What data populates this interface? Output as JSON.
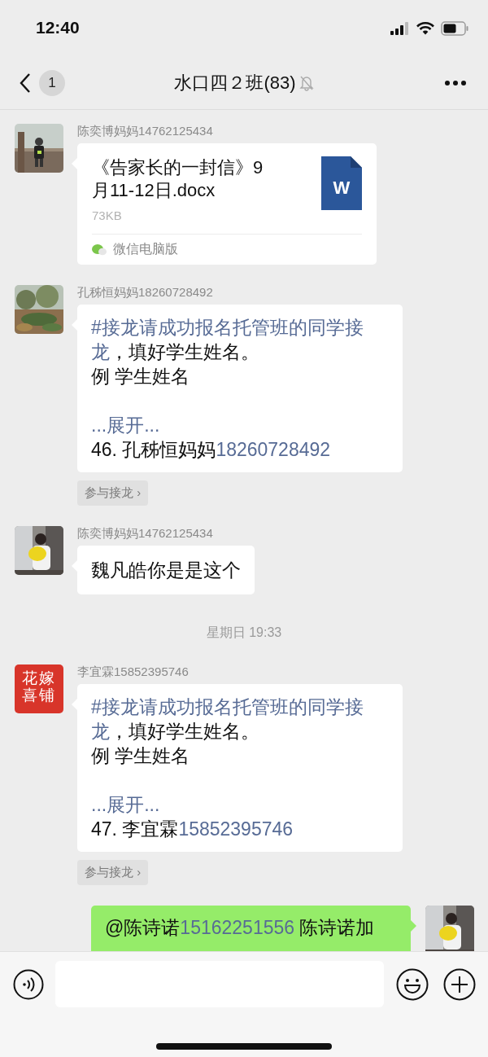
{
  "status_bar": {
    "time": "12:40"
  },
  "nav": {
    "back_count": "1",
    "title": "水口四２班(83)",
    "muted": true
  },
  "messages": [
    {
      "kind": "file",
      "sender": "陈奕博妈妈14762125434",
      "avatar": {
        "kind": "picture"
      },
      "file_name": "《告家长的一封信》9月11-12日.docx",
      "file_size": "73KB",
      "file_badge": "W",
      "source": "微信电脑版"
    },
    {
      "kind": "jielong",
      "sender": "孔秭恒妈妈18260728492",
      "avatar": {
        "kind": "picture"
      },
      "intro_link": "#接龙请成功报名托管班的同学接",
      "intro": [
        {
          "kind": "link",
          "text": "龙"
        },
        {
          "kind": "plain",
          "text": "，填好学生姓名。"
        }
      ],
      "example": "例 学生姓名",
      "expand": "...展开...",
      "entry": [
        {
          "kind": "plain",
          "text": "46. 孔秭恒妈妈"
        },
        {
          "kind": "link",
          "text": "18260728492"
        }
      ],
      "action": "参与接龙 ›"
    },
    {
      "kind": "text",
      "outgoing": false,
      "sender": "陈奕博妈妈14762125434",
      "avatar": {
        "kind": "picture"
      },
      "segments": [
        {
          "kind": "plain",
          "text": "魏凡皓你是是这个"
        }
      ]
    },
    {
      "kind": "time",
      "text": "星期日 19:33"
    },
    {
      "kind": "jielong",
      "sender": "李宜霖15852395746",
      "avatar": {
        "kind": "logo",
        "lines": [
          "花嫁",
          "喜铺"
        ]
      },
      "intro_link": "#接龙请成功报名托管班的同学接",
      "intro": [
        {
          "kind": "link",
          "text": "龙"
        },
        {
          "kind": "plain",
          "text": "，填好学生姓名。"
        }
      ],
      "example": "例 学生姓名",
      "expand": "...展开...",
      "entry": [
        {
          "kind": "plain",
          "text": "47. 李宜霖"
        },
        {
          "kind": "link",
          "text": "15852395746"
        }
      ],
      "action": "参与接龙 ›"
    },
    {
      "kind": "text",
      "outgoing": true,
      "avatar": {
        "kind": "picture"
      },
      "segments": [
        {
          "kind": "plain",
          "text": "@陈诗诺"
        },
        {
          "kind": "link",
          "text": "15162251556"
        },
        {
          "kind": "plain",
          "text": " 陈诗诺加"
        }
      ]
    }
  ]
}
